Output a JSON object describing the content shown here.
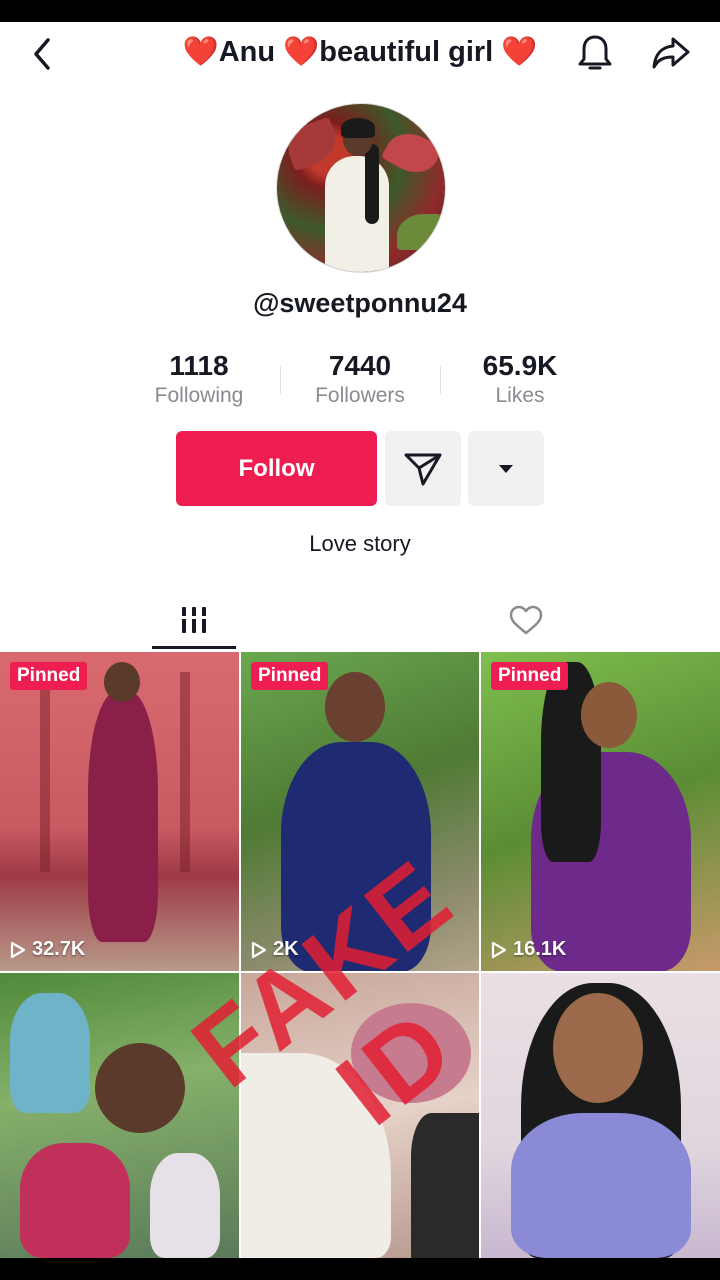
{
  "header": {
    "title": "❤️Anu ❤️beautiful girl ❤️",
    "back_icon": "chevron-left-icon",
    "bell_icon": "bell-icon",
    "share_icon": "share-arrow-icon"
  },
  "profile": {
    "username": "@sweetponnu24",
    "bio": "Love story",
    "stats": [
      {
        "value": "1118",
        "label": "Following"
      },
      {
        "value": "7440",
        "label": "Followers"
      },
      {
        "value": "65.9K",
        "label": "Likes"
      }
    ]
  },
  "actions": {
    "follow_label": "Follow",
    "message_icon": "paper-plane-icon",
    "more_icon": "caret-down-icon",
    "accent_color": "#ee1d52"
  },
  "tabs": {
    "videos_icon": "grid-bars-icon",
    "liked_icon": "heart-outline-icon"
  },
  "videos": [
    {
      "pinned_label": "Pinned",
      "views": "32.7K"
    },
    {
      "pinned_label": "Pinned",
      "views": "2K"
    },
    {
      "pinned_label": "Pinned",
      "views": "16.1K"
    },
    {
      "pinned_label": "",
      "views": ""
    },
    {
      "pinned_label": "",
      "views": ""
    },
    {
      "pinned_label": "",
      "views": ""
    }
  ],
  "overlay": {
    "watermark_text": "FAKE ID"
  }
}
